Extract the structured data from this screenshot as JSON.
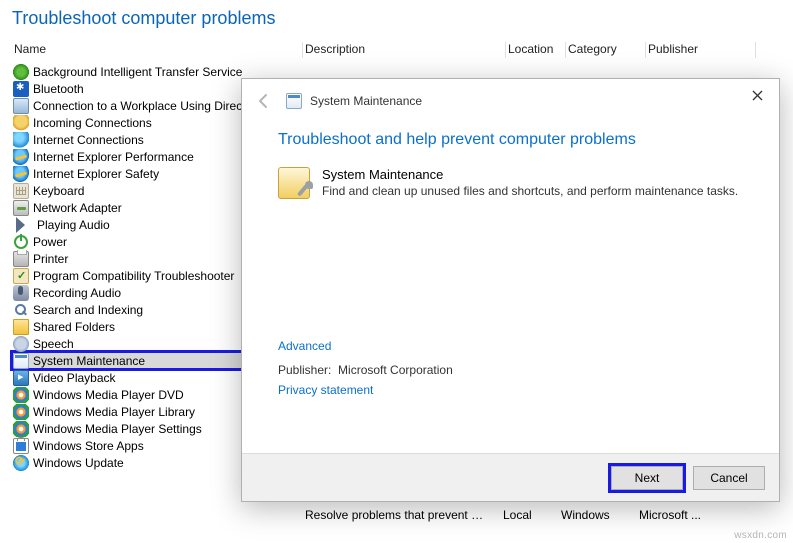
{
  "page_title": "Troubleshoot computer problems",
  "columns": {
    "name": "Name",
    "description": "Description",
    "location": "Location",
    "category": "Category",
    "publisher": "Publisher"
  },
  "troubleshooters": [
    {
      "label": "Background Intelligent Transfer Service",
      "icon": "ic-bits"
    },
    {
      "label": "Bluetooth",
      "icon": "ic-bluetooth"
    },
    {
      "label": "Connection to a Workplace Using DirectAccess",
      "icon": "ic-workplace"
    },
    {
      "label": "Incoming Connections",
      "icon": "ic-incoming"
    },
    {
      "label": "Internet Connections",
      "icon": "ic-internet"
    },
    {
      "label": "Internet Explorer Performance",
      "icon": "ic-ie"
    },
    {
      "label": "Internet Explorer Safety",
      "icon": "ic-ie"
    },
    {
      "label": "Keyboard",
      "icon": "ic-keyboard"
    },
    {
      "label": "Network Adapter",
      "icon": "ic-network"
    },
    {
      "label": "Playing Audio",
      "icon": "ic-audio"
    },
    {
      "label": "Power",
      "icon": "ic-power"
    },
    {
      "label": "Printer",
      "icon": "ic-printer"
    },
    {
      "label": "Program Compatibility Troubleshooter",
      "icon": "ic-compat"
    },
    {
      "label": "Recording Audio",
      "icon": "ic-mic"
    },
    {
      "label": "Search and Indexing",
      "icon": "ic-search"
    },
    {
      "label": "Shared Folders",
      "icon": "ic-folder"
    },
    {
      "label": "Speech",
      "icon": "ic-speech"
    },
    {
      "label": "System Maintenance",
      "icon": "ic-sysm",
      "selected": true,
      "highlight": true
    },
    {
      "label": "Video Playback",
      "icon": "ic-video"
    },
    {
      "label": "Windows Media Player DVD",
      "icon": "ic-wmp"
    },
    {
      "label": "Windows Media Player Library",
      "icon": "ic-wmp"
    },
    {
      "label": "Windows Media Player Settings",
      "icon": "ic-wmp"
    },
    {
      "label": "Windows Store Apps",
      "icon": "ic-store"
    },
    {
      "label": "Windows Update",
      "icon": "ic-update"
    }
  ],
  "peek_row": {
    "description": "Resolve problems that prevent yo...",
    "location": "Local",
    "category": "Windows",
    "publisher": "Microsoft ..."
  },
  "wizard": {
    "header_title": "System Maintenance",
    "heading": "Troubleshoot and help prevent computer problems",
    "item_title": "System Maintenance",
    "item_desc": "Find and clean up unused files and shortcuts, and perform maintenance tasks.",
    "advanced": "Advanced",
    "publisher_label": "Publisher:",
    "publisher_value": "Microsoft Corporation",
    "privacy": "Privacy statement",
    "next": "Next",
    "cancel": "Cancel"
  },
  "watermark": "wsxdn.com"
}
